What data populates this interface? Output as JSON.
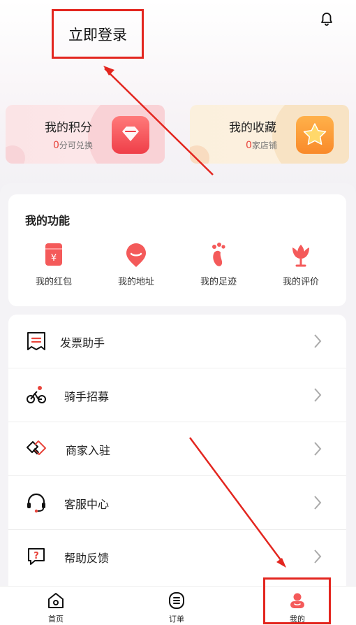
{
  "header": {
    "login_label": "立即登录",
    "bell_icon": "bell-icon"
  },
  "cards": {
    "points": {
      "title": "我的积分",
      "count": "0",
      "suffix": "分可兑换",
      "icon": "gem-icon"
    },
    "favorites": {
      "title": "我的收藏",
      "count": "0",
      "suffix": "家店铺",
      "icon": "star-icon"
    }
  },
  "functions": {
    "title": "我的功能",
    "items": [
      {
        "label": "我的红包",
        "icon": "red-envelope-icon"
      },
      {
        "label": "我的地址",
        "icon": "location-icon"
      },
      {
        "label": "我的足迹",
        "icon": "footprint-icon"
      },
      {
        "label": "我的评价",
        "icon": "tulip-icon"
      }
    ]
  },
  "menu": {
    "items": [
      {
        "label": "发票助手",
        "icon": "invoice-icon"
      },
      {
        "label": "骑手招募",
        "icon": "bicycle-icon"
      },
      {
        "label": "商家入驻",
        "icon": "handshake-icon"
      },
      {
        "label": "客服中心",
        "icon": "headset-icon"
      },
      {
        "label": "帮助反馈",
        "icon": "help-icon"
      }
    ]
  },
  "tabbar": {
    "items": [
      {
        "label": "首页",
        "icon": "home-icon"
      },
      {
        "label": "订单",
        "icon": "order-icon"
      },
      {
        "label": "我的",
        "icon": "user-icon"
      }
    ]
  },
  "colors": {
    "accent": "#e8453c",
    "annotation": "#e3261f"
  }
}
